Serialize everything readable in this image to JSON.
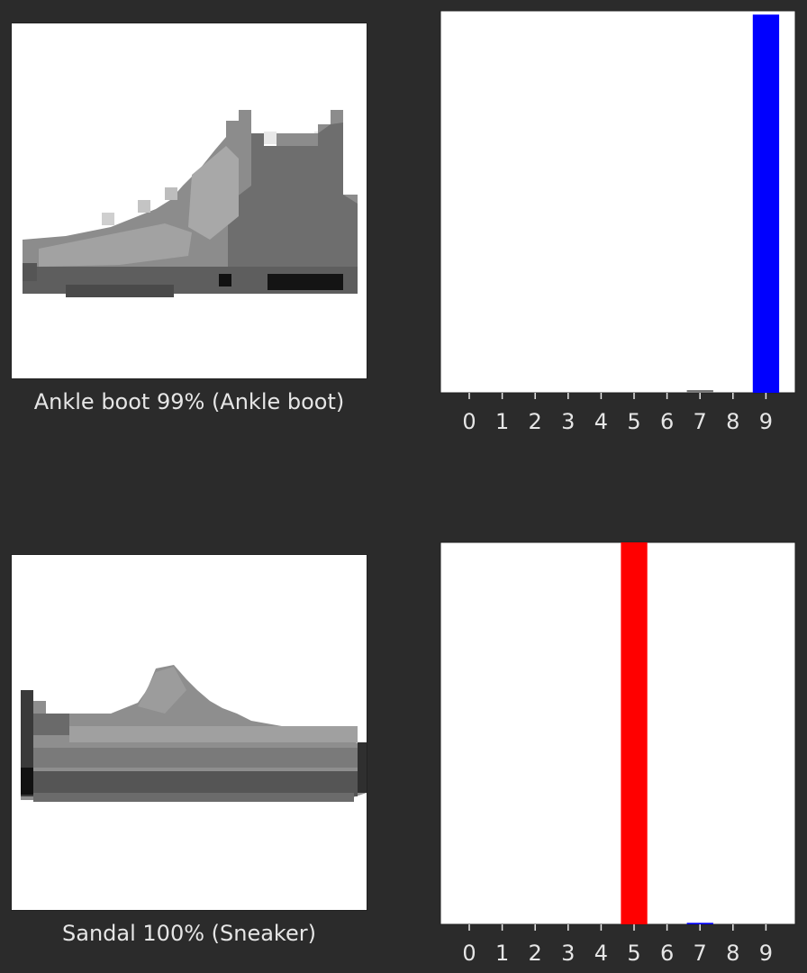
{
  "panels": [
    {
      "caption": "Ankle boot 99% (Ankle boot)",
      "image": "ankle-boot-thumbnail"
    },
    {
      "caption": "Sandal 100% (Sneaker)",
      "image": "sneaker-thumbnail"
    }
  ],
  "colors": {
    "background": "#2b2b2b",
    "default_bar": "#777777",
    "predicted_wrong": "#ff0000",
    "true_label": "#0000ff",
    "tick_text": "#e6e6e6"
  },
  "chart_data": [
    {
      "type": "bar",
      "categories": [
        "0",
        "1",
        "2",
        "3",
        "4",
        "5",
        "6",
        "7",
        "8",
        "9"
      ],
      "values": [
        0,
        0,
        0,
        0,
        0,
        0,
        0,
        0.007,
        0,
        0.99
      ],
      "ylim": [
        0,
        1
      ],
      "predicted_label": 9,
      "true_label": 9,
      "grid": false,
      "title": "",
      "xlabel": "",
      "ylabel": ""
    },
    {
      "type": "bar",
      "categories": [
        "0",
        "1",
        "2",
        "3",
        "4",
        "5",
        "6",
        "7",
        "8",
        "9"
      ],
      "values": [
        0,
        0,
        0,
        0,
        0,
        1.0,
        0,
        0.004,
        0,
        0
      ],
      "ylim": [
        0,
        1
      ],
      "predicted_label": 5,
      "true_label": 7,
      "grid": false,
      "title": "",
      "xlabel": "",
      "ylabel": ""
    }
  ]
}
